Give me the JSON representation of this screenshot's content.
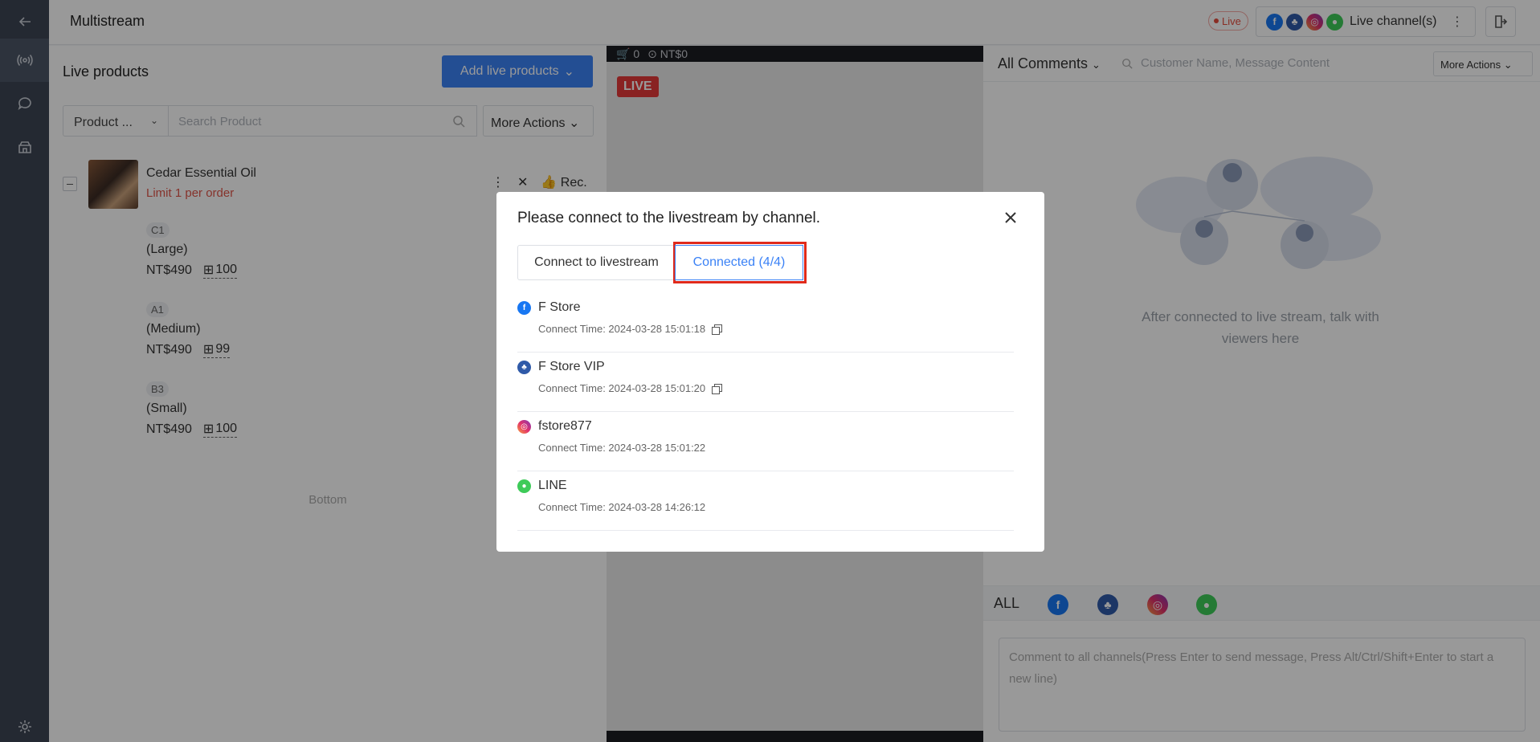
{
  "header": {
    "title": "Multistream",
    "live_label": "Live",
    "channels_label": "Live channel(s)",
    "more_symbol": "⋮"
  },
  "products": {
    "title": "Live products",
    "add_button": "Add live products",
    "filter_select": "Product ...",
    "search_placeholder": "Search Product",
    "more_actions": "More Actions",
    "item": {
      "name": "Cedar Essential Oil",
      "limit": "Limit 1 per order",
      "rec_label": "Rec.",
      "variants": [
        {
          "code": "C1",
          "size": "(Large)",
          "price": "NT$490",
          "stock": "100"
        },
        {
          "code": "A1",
          "size": "(Medium)",
          "price": "NT$490",
          "stock": "99"
        },
        {
          "code": "B3",
          "size": "(Small)",
          "price": "NT$490",
          "stock": "100"
        }
      ]
    },
    "bottom_text": "Bottom"
  },
  "video": {
    "cart_count": "0",
    "amount": "NT$0",
    "live_badge": "LIVE"
  },
  "comments": {
    "filter_label": "All Comments",
    "search_placeholder": "Customer Name, Message Content",
    "more_actions": "More Actions",
    "empty_text": "After connected to live stream, talk with viewers here",
    "tab_all": "ALL",
    "input_placeholder": "Comment to all channels(Press Enter to send message, Press Alt/Ctrl/Shift+Enter to start a new line)"
  },
  "modal": {
    "title": "Please connect to the livestream by channel.",
    "tab_connect": "Connect to livestream",
    "tab_connected": "Connected (4/4)",
    "connections": [
      {
        "icon": "facebook-icon",
        "name": "F Store",
        "time": "Connect Time: 2024-03-28 15:01:18",
        "copy": true
      },
      {
        "icon": "group-icon",
        "name": "F Store VIP",
        "time": "Connect Time: 2024-03-28 15:01:20",
        "copy": true
      },
      {
        "icon": "instagram-icon",
        "name": "fstore877",
        "time": "Connect Time: 2024-03-28 15:01:22",
        "copy": false
      },
      {
        "icon": "line-icon",
        "name": "LINE",
        "time": "Connect Time: 2024-03-28 14:26:12",
        "copy": false
      }
    ]
  },
  "colors": {
    "primary": "#3b82f6",
    "highlight": "#e02a1b",
    "live": "#e53a3a",
    "rail": "#3d4554"
  }
}
